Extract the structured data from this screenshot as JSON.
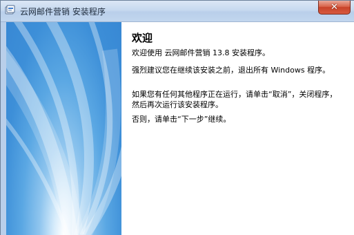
{
  "window": {
    "title": "云网邮件营销 安装程序",
    "close_glyph": "✕"
  },
  "icons": {
    "app": "installer-icon",
    "close": "close-icon"
  },
  "welcome": {
    "heading": "欢迎",
    "paragraphs": [
      "欢迎使用 云网邮件营销 13.8 安装程序。",
      "强烈建议您在继续该安装之前，退出所有 Windows 程序。",
      "如果您有任何其他程序正在运行，请单击“取消”，关闭程序，然后再次运行该安装程序。",
      "否则，请单击“下一步”继续。"
    ]
  },
  "colors": {
    "titlebar": "#c7d9ef",
    "close_button": "#c8432a",
    "side_panel": "#3d8fd8"
  }
}
